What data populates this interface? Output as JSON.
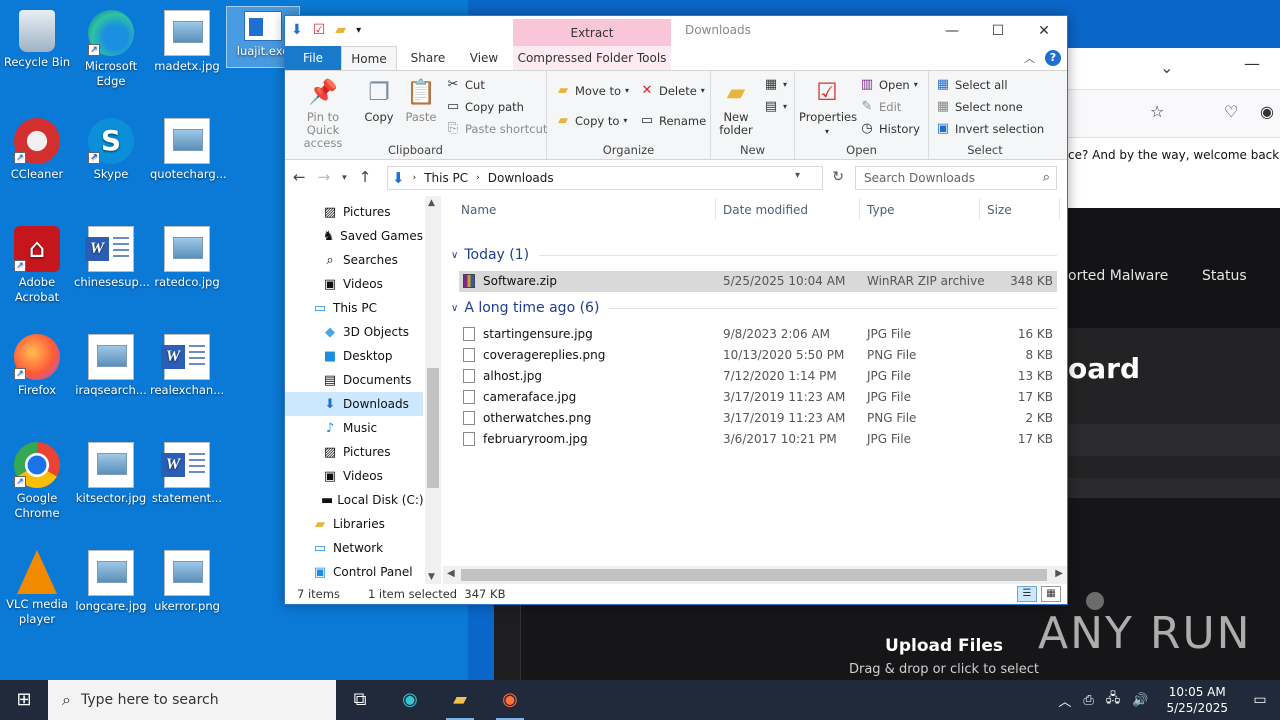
{
  "desktop": {
    "icons": [
      {
        "label": "Recycle Bin"
      },
      {
        "label": "Microsoft Edge"
      },
      {
        "label": "madetx.jpg"
      },
      {
        "label": "luajit.exe"
      },
      {
        "label": "CCleaner"
      },
      {
        "label": "Skype"
      },
      {
        "label": "quotecharg..."
      },
      {
        "label": "Adobe Acrobat"
      },
      {
        "label": "chinesesup..."
      },
      {
        "label": "ratedco.jpg"
      },
      {
        "label": "Firefox"
      },
      {
        "label": "iraqsearch..."
      },
      {
        "label": "realexchan..."
      },
      {
        "label": "Google Chrome"
      },
      {
        "label": "kitsector.jpg"
      },
      {
        "label": "statement..."
      },
      {
        "label": "VLC media player"
      },
      {
        "label": "longcare.jpg"
      },
      {
        "label": "ukerror.png"
      }
    ]
  },
  "browser": {
    "notice": "ce? And by the way, welcome back!",
    "nav_item_1": "orted Malware",
    "nav_item_2": "Status",
    "board_title": "oard",
    "upload_title": "Upload Files",
    "upload_sub": "Drag & drop or click to select",
    "watermark": "ANY RUN"
  },
  "explorer": {
    "title": "Downloads",
    "extract_tab": "Extract",
    "tabs": {
      "file": "File",
      "home": "Home",
      "share": "Share",
      "view": "View",
      "cft": "Compressed Folder Tools"
    },
    "ribbon": {
      "clipboard": {
        "label": "Clipboard",
        "pin": "Pin to Quick access",
        "copy": "Copy",
        "paste": "Paste",
        "cut": "Cut",
        "copy_path": "Copy path",
        "paste_shortcut": "Paste shortcut"
      },
      "organize": {
        "label": "Organize",
        "move_to": "Move to",
        "copy_to": "Copy to",
        "delete": "Delete",
        "rename": "Rename"
      },
      "new": {
        "label": "New",
        "new_folder": "New folder"
      },
      "open": {
        "label": "Open",
        "properties": "Properties",
        "open": "Open",
        "edit": "Edit",
        "history": "History"
      },
      "select": {
        "label": "Select",
        "select_all": "Select all",
        "select_none": "Select none",
        "invert": "Invert selection"
      }
    },
    "address": {
      "crumbs": [
        "This PC",
        "Downloads"
      ],
      "search_placeholder": "Search Downloads"
    },
    "nav": [
      {
        "label": "Pictures",
        "icon": "pictures-icon"
      },
      {
        "label": "Saved Games",
        "icon": "saved-games-icon"
      },
      {
        "label": "Searches",
        "icon": "searches-icon"
      },
      {
        "label": "Videos",
        "icon": "videos-icon"
      },
      {
        "label": "This PC",
        "icon": "pc-icon"
      },
      {
        "label": "3D Objects",
        "icon": "cube-icon"
      },
      {
        "label": "Desktop",
        "icon": "desktop-icon"
      },
      {
        "label": "Documents",
        "icon": "documents-icon"
      },
      {
        "label": "Downloads",
        "icon": "downloads-icon"
      },
      {
        "label": "Music",
        "icon": "music-icon"
      },
      {
        "label": "Pictures",
        "icon": "pictures-icon"
      },
      {
        "label": "Videos",
        "icon": "videos-icon"
      },
      {
        "label": "Local Disk (C:)",
        "icon": "disk-icon"
      },
      {
        "label": "Libraries",
        "icon": "libraries-icon"
      },
      {
        "label": "Network",
        "icon": "network-icon"
      },
      {
        "label": "Control Panel",
        "icon": "control-panel-icon"
      }
    ],
    "columns": {
      "name": "Name",
      "date": "Date modified",
      "type": "Type",
      "size": "Size"
    },
    "groups": [
      {
        "label": "Today (1)",
        "files": [
          {
            "name": "Software.zip",
            "date": "5/25/2025 10:04 AM",
            "type": "WinRAR ZIP archive",
            "size": "348 KB"
          }
        ]
      },
      {
        "label": "A long time ago (6)",
        "files": [
          {
            "name": "startingensure.jpg",
            "date": "9/8/2023 2:06 AM",
            "type": "JPG File",
            "size": "16 KB"
          },
          {
            "name": "coveragereplies.png",
            "date": "10/13/2020 5:50 PM",
            "type": "PNG File",
            "size": "8 KB"
          },
          {
            "name": "alhost.jpg",
            "date": "7/12/2020 1:14 PM",
            "type": "JPG File",
            "size": "13 KB"
          },
          {
            "name": "cameraface.jpg",
            "date": "3/17/2019 11:23 AM",
            "type": "JPG File",
            "size": "17 KB"
          },
          {
            "name": "otherwatches.png",
            "date": "3/17/2019 11:23 AM",
            "type": "PNG File",
            "size": "2 KB"
          },
          {
            "name": "februaryroom.jpg",
            "date": "3/6/2017 10:21 PM",
            "type": "JPG File",
            "size": "17 KB"
          }
        ]
      }
    ],
    "status": {
      "items": "7 items",
      "selected": "1 item selected",
      "size": "347 KB"
    }
  },
  "taskbar": {
    "search_placeholder": "Type here to search",
    "time": "10:05 AM",
    "date": "5/25/2025"
  }
}
